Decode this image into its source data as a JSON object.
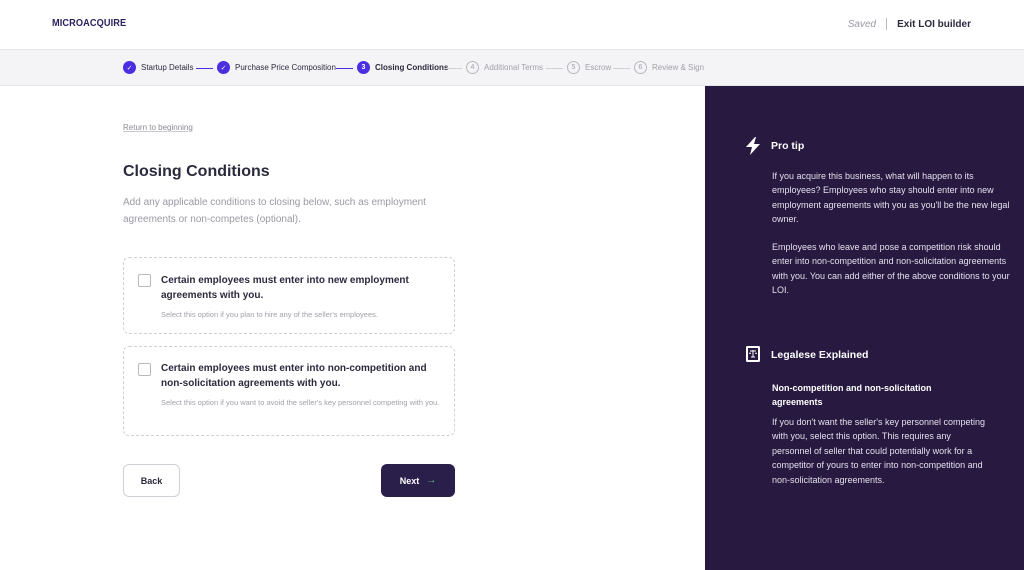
{
  "header": {
    "logo": "MICROACQUIRE",
    "saved_label": "Saved",
    "exit_label": "Exit LOI builder"
  },
  "stepper": {
    "steps": [
      {
        "label": "Startup Details",
        "badge": "✓",
        "state": "done"
      },
      {
        "label": "Purchase Price Composition",
        "badge": "✓",
        "state": "done"
      },
      {
        "label": "Closing Conditions",
        "badge": "3",
        "state": "active"
      },
      {
        "label": "Additional Terms",
        "badge": "4",
        "state": "todo"
      },
      {
        "label": "Escrow",
        "badge": "5",
        "state": "todo"
      },
      {
        "label": "Review & Sign",
        "badge": "6",
        "state": "todo"
      }
    ]
  },
  "main": {
    "return_link": "Return to beginning",
    "title": "Closing Conditions",
    "description": "Add any applicable conditions to closing below, such as employment agreements or non-competes (optional).",
    "options": [
      {
        "title": "Certain employees must enter into new employment agreements with you.",
        "subtitle": "Select this option if you plan to hire any of the seller's employees.",
        "checked": false
      },
      {
        "title": "Certain employees must enter into non-competition and non-solicitation agreements with you.",
        "subtitle": "Select this option if you want to avoid the seller's key personnel competing with you.",
        "checked": false
      }
    ],
    "back_label": "Back",
    "next_label": "Next",
    "next_arrow": "→"
  },
  "sidebar": {
    "pro_tip": {
      "heading": "Pro tip",
      "icon": "lightning-icon",
      "paragraph1": "If you acquire this business, what will happen to its employees? Employees who stay should enter into new employment agreements with you as you'll be the new legal owner.",
      "paragraph2": "Employees who leave and pose a competition risk should enter into non-competition and non-solicitation agreements with you. You can add either of the above conditions to your LOI."
    },
    "legalese": {
      "heading": "Legalese Explained",
      "icon": "legal-book-icon",
      "term": "Non-competition and non-solicitation agreements",
      "explanation": "If you don't want the seller's key personnel competing with you, select this option. This requires any personnel of seller that could potentially work for a competitor of yours to enter into non-competition and non-solicitation agreements."
    }
  },
  "colors": {
    "accent": "#4a2ee0",
    "sidebar_bg": "#27193f",
    "next_button_bg": "#2a1e4a",
    "next_arrow": "#5fd38a"
  }
}
